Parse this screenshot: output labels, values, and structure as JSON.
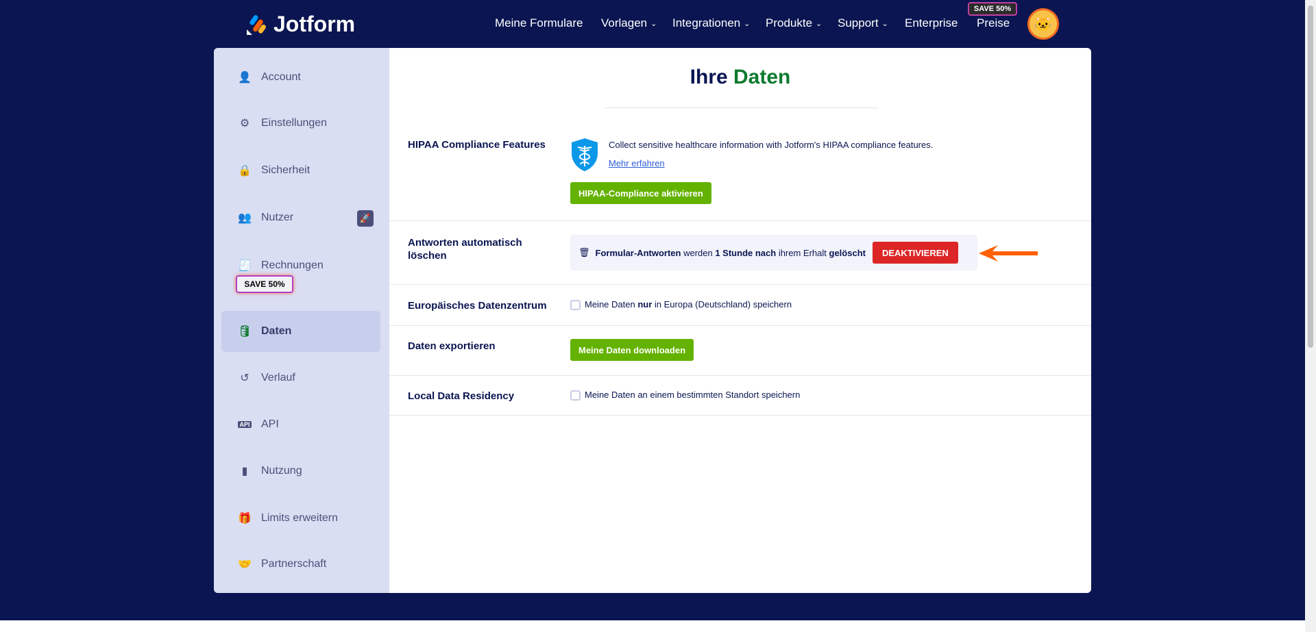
{
  "header": {
    "logo": "Jotform",
    "nav": [
      {
        "label": "Meine Formulare",
        "dropdown": false
      },
      {
        "label": "Vorlagen",
        "dropdown": true
      },
      {
        "label": "Integrationen",
        "dropdown": true
      },
      {
        "label": "Produkte",
        "dropdown": true
      },
      {
        "label": "Support",
        "dropdown": true
      },
      {
        "label": "Enterprise",
        "dropdown": false
      },
      {
        "label": "Preise",
        "dropdown": false
      }
    ],
    "save_badge": "SAVE 50%"
  },
  "sidebar": {
    "items": [
      {
        "label": "Account",
        "icon": "user-icon"
      },
      {
        "label": "Einstellungen",
        "icon": "gear-icon"
      },
      {
        "label": "Sicherheit",
        "icon": "lock-icon"
      },
      {
        "label": "Nutzer",
        "icon": "users-icon"
      },
      {
        "label": "Rechnungen",
        "icon": "invoice-icon"
      },
      {
        "label": "Daten",
        "icon": "database-icon"
      },
      {
        "label": "Verlauf",
        "icon": "history-icon"
      },
      {
        "label": "API",
        "icon": "api-icon"
      },
      {
        "label": "Nutzung",
        "icon": "bar-chart-icon"
      },
      {
        "label": "Limits erweitern",
        "icon": "gift-icon"
      },
      {
        "label": "Partnerschaft",
        "icon": "handshake-icon"
      }
    ],
    "save_badge": "SAVE 50%",
    "active": "Daten"
  },
  "main": {
    "title_a": "Ihre",
    "title_b": "Daten",
    "hipaa": {
      "label": "HIPAA Compliance Features",
      "text": "Collect sensitive healthcare information with Jotform's HIPAA compliance features.",
      "link": "Mehr erfahren",
      "button": "HIPAA-Compliance aktivieren"
    },
    "autodelete": {
      "label": "Antworten automatisch löschen",
      "t1": "Formular-Antworten",
      "t2": " werden ",
      "t3": "1 Stunde nach",
      "t4": " ihrem Erhalt ",
      "t5": "gelöscht",
      "button": "DEAKTIVIEREN"
    },
    "eu": {
      "label": "Europäisches Datenzentrum",
      "t1": "Meine Daten ",
      "t2": "nur",
      "t3": " in Europa (Deutschland) speichern",
      "checked": false
    },
    "export": {
      "label": "Daten exportieren",
      "button": "Meine Daten downloaden"
    },
    "residency": {
      "label": "Local Data Residency",
      "text": "Meine Daten an einem bestimmten Standort speichern",
      "checked": false
    }
  },
  "colors": {
    "bg": "#0a1551",
    "green": "#64b200",
    "red": "#dc2626",
    "arrow": "#ff6100"
  }
}
